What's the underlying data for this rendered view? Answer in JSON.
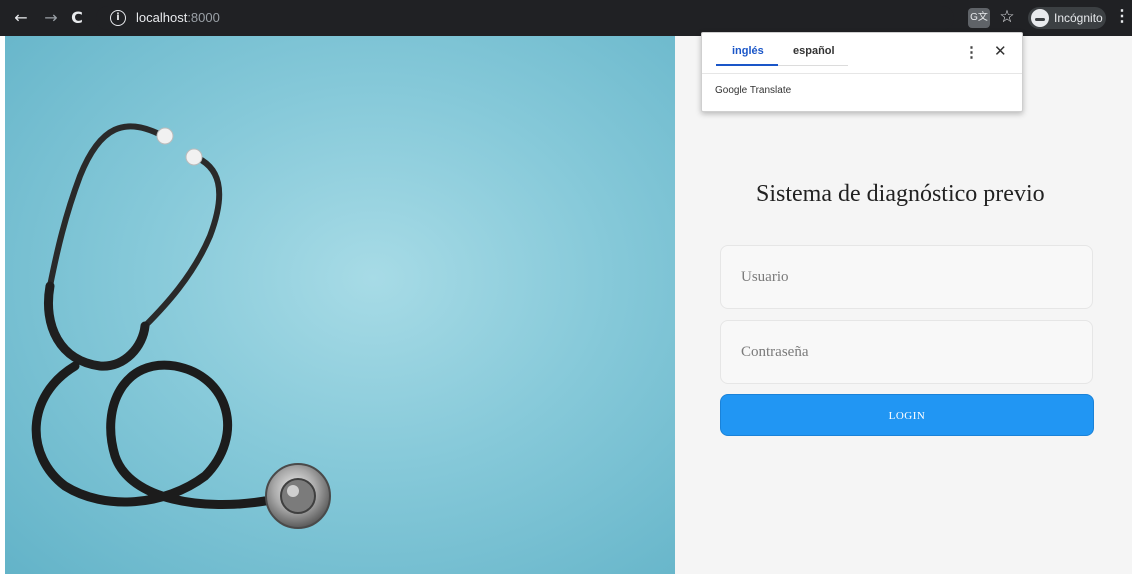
{
  "browser": {
    "back_icon": "←",
    "forward_icon": "→",
    "reload_icon": "C",
    "url_host": "localhost",
    "url_port": ":8000",
    "info_icon": "i",
    "translate_icon_label": "G文",
    "star_icon": "☆",
    "incognito_label": "Incógnito",
    "menu_icon": "⋮"
  },
  "translate_popup": {
    "tab_source": "inglés",
    "tab_target": "español",
    "more_icon": "⋮",
    "close_icon": "✕",
    "footer": "Google Translate"
  },
  "login": {
    "title": "Sistema de diagnóstico previo",
    "username_placeholder": "Usuario",
    "password_placeholder": "Contraseña",
    "button_label": "LOGIN"
  },
  "colors": {
    "toolbar_bg": "#202124",
    "background_photo": "#86c9d9",
    "right_panel": "#f5f5f5",
    "login_button": "#2196f3",
    "translate_accent": "#1a56c8"
  }
}
